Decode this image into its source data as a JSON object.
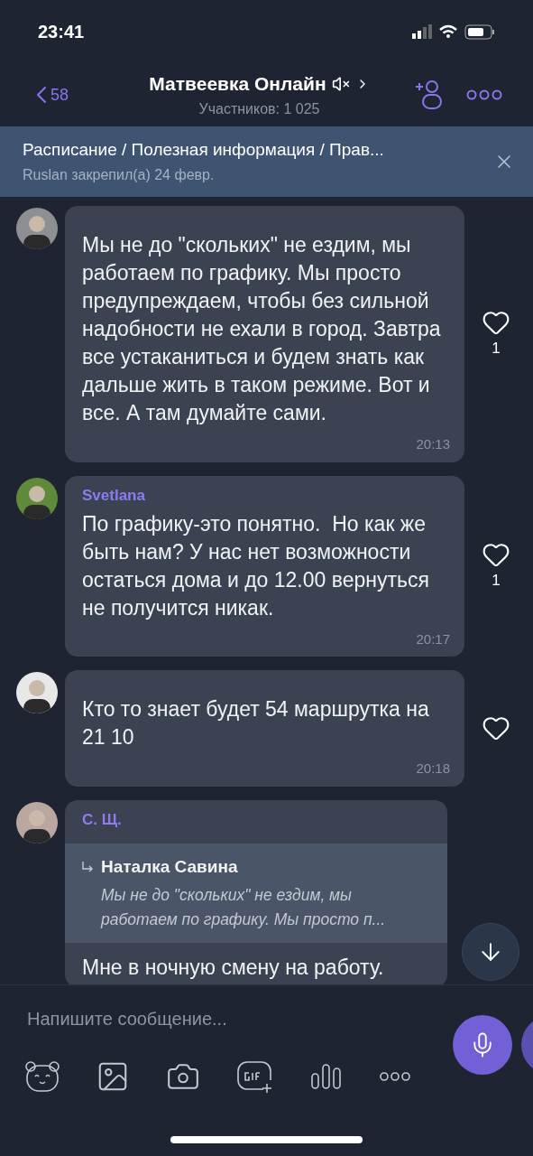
{
  "status_bar": {
    "time": "23:41"
  },
  "header": {
    "back_count": "58",
    "title": "Матвеевка Онлайн",
    "muted": true,
    "subtitle": "Участников: 1 025"
  },
  "pinned": {
    "title": "Расписание / Полезная информация / Прав...",
    "subtitle": "Ruslan закрепил(а) 24 февр."
  },
  "messages": [
    {
      "text": "Мы не до \"скольких\" не ездим, мы работаем по графику. Мы просто предупреждаем, чтобы без сильной надобности не ехали в город. Завтра все устаканиться и будем знать как дальше жить в таком режиме. Вот и все. А там думайте сами.",
      "time": "20:13",
      "liked": false,
      "likes": "1"
    },
    {
      "sender": "Svetlana",
      "text": "По графику-это понятно.  Но как же быть нам? У нас нет возможности остаться дома и до 12.00 вернуться не получится никак.",
      "time": "20:17",
      "liked": false,
      "likes": "1"
    },
    {
      "text": "Кто то знает будет 54 маршрутка на 21 10",
      "time": "20:18",
      "liked": false
    },
    {
      "sender": "С. Щ.",
      "reply": {
        "author": "Наталка Савина",
        "text": "Мы не до \"скольких\" не ездим, мы работаем по графику. Мы просто п..."
      },
      "text": "Мне в ночную смену на работу."
    }
  ],
  "composer": {
    "placeholder": "Напишите сообщение..."
  }
}
